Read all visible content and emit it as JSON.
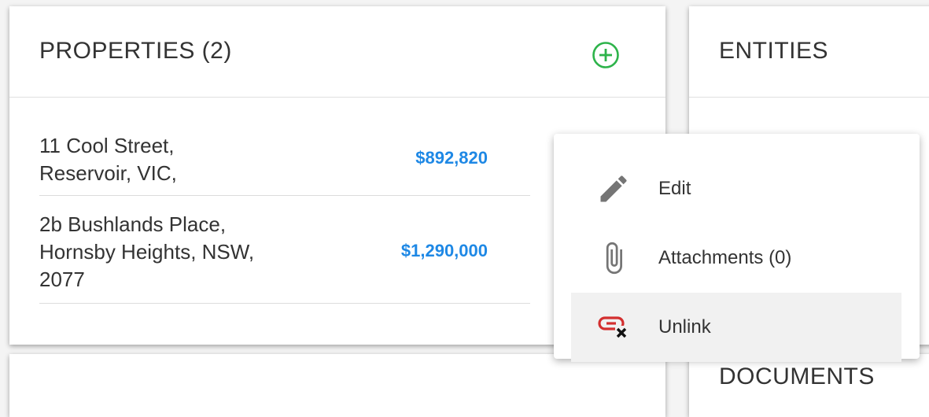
{
  "properties": {
    "title": "PROPERTIES (2)",
    "add_icon": "add-circle-icon",
    "items": [
      {
        "address_lines": [
          "11 Cool Street,",
          "Reservoir, VIC,"
        ],
        "value": "$892,820"
      },
      {
        "address_lines": [
          "2b Bushlands Place,",
          "Hornsby Heights, NSW,",
          "2077"
        ],
        "value": "$1,290,000"
      }
    ]
  },
  "entities": {
    "title": "ENTITIES"
  },
  "documents": {
    "title": "DOCUMENTS"
  },
  "context_menu": {
    "items": [
      {
        "label": "Edit",
        "icon": "pencil-icon"
      },
      {
        "label": "Attachments (0)",
        "icon": "paperclip-icon"
      },
      {
        "label": "Unlink",
        "icon": "unlink-icon",
        "highlighted": true
      }
    ]
  },
  "colors": {
    "accent_blue": "#1e88e5",
    "add_green": "#2db34a",
    "unlink_red": "#d32f2f",
    "icon_grey": "#757575"
  }
}
